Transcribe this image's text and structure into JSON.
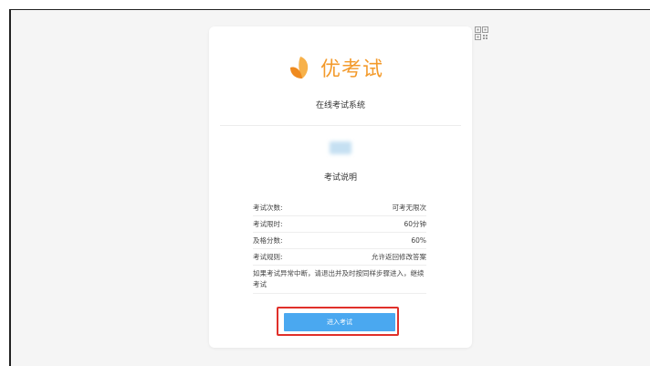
{
  "app": {
    "logo_text": "优考试",
    "system_name": "在线考试系统"
  },
  "header": {
    "qr_icon": "qr-code-icon"
  },
  "exam": {
    "section_title": "考试说明",
    "rows": [
      {
        "label": "考试次数:",
        "value": "可考无限次"
      },
      {
        "label": "考试限时:",
        "value": "60分钟"
      },
      {
        "label": "及格分数:",
        "value": "60%"
      },
      {
        "label": "考试规则:",
        "value": "允许返回修改答案"
      }
    ],
    "note": "如果考试异常中断，请退出并及时按同样步骤进入，继续考试",
    "start_button": "进入考试"
  },
  "colors": {
    "brand": "#f39a2b",
    "button": "#4aa8f0",
    "highlight": "#e0302a"
  }
}
